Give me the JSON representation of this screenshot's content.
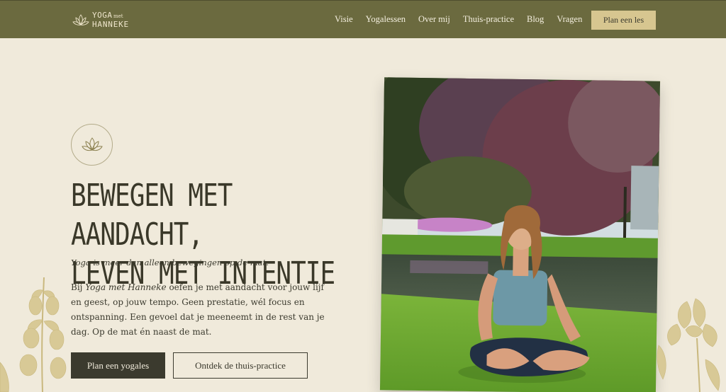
{
  "brand": {
    "line1": "YOGA",
    "line2": "met",
    "line3": "HANNEKE"
  },
  "nav": {
    "items": [
      "Visie",
      "Yogalessen",
      "Over mij",
      "Thuis-practice",
      "Blog",
      "Vragen"
    ],
    "cta": "Plan een les"
  },
  "hero": {
    "headline_line1": "BEWEGEN MET AANDACHT,",
    "headline_line2": "LEVEN MET INTENTIE",
    "tagline": "Yoga is meer dan alleen bewegingen op de mat.",
    "body_prefix": "Bij ",
    "body_brand": "Yoga met Hanneke",
    "body_rest": " oefen je met aandacht voor jouw lijf en geest, op jouw tempo. Geen prestatie, wél focus en ontspanning. Een gevoel dat je meeneemt in de rest van je dag. Op de mat én naast de mat.",
    "primary_button": "Plan een yogales",
    "secondary_button": "Ontdek de thuis-practice"
  },
  "colors": {
    "nav_bg": "#6b6a3f",
    "page_bg": "#f0eadb",
    "cta_bg": "#d7c690",
    "dark": "#3b3a2e",
    "botanical": "#d8c996"
  },
  "icons": {
    "logo": "lotus-icon",
    "badge": "lotus-icon"
  }
}
